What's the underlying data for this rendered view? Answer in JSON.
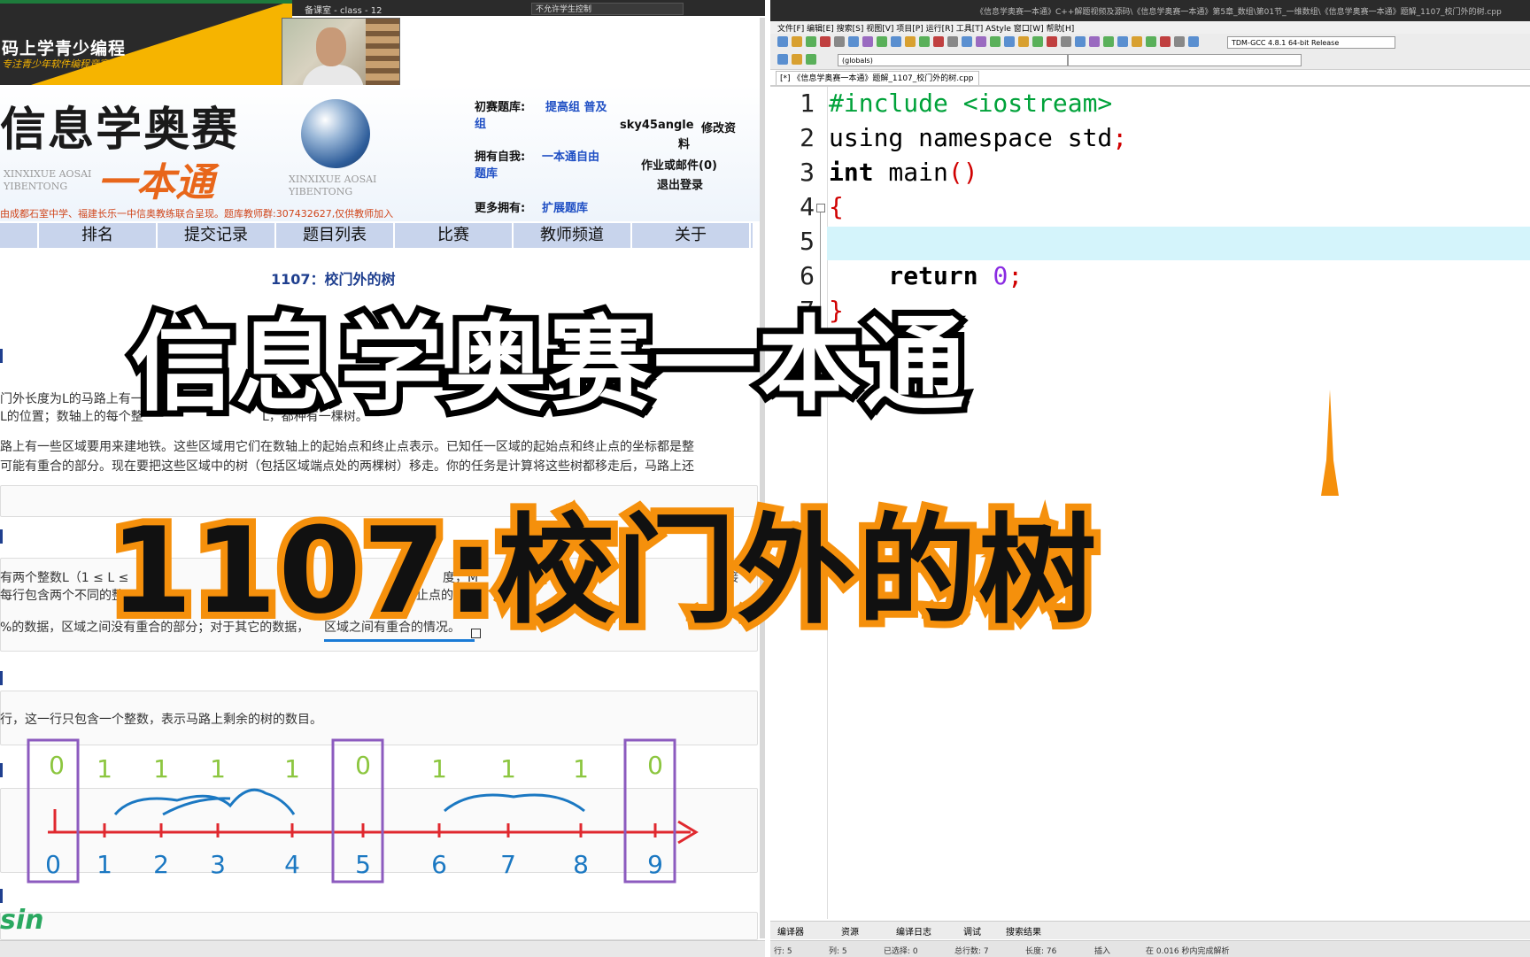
{
  "left_page": {
    "class_title": "备课室 - class - 12",
    "logo_text": "码上学青少编程",
    "logo_sub": "专注青少年软件编程竞赛",
    "brand_big": "信息学奥赛",
    "brand_pinyin": "XINXIXUE AOSAI YIBENTONG",
    "brand_yibentong": "一本通",
    "brand_pinyin2": "XINXIXUE AOSAI YIBENTONG",
    "brand_credit": "由成都石室中学、福建长乐一中信奥教练联合呈现。题库教师群:307432627,仅供教师加入",
    "info": {
      "prelim_label": "初赛题库:",
      "prelim_link": "提高组 普及组",
      "self_label": "拥有自我:",
      "self_link": "一本通自由题库",
      "more_label": "更多拥有:",
      "more_link": "扩展题库"
    },
    "user": {
      "name": "sky45angle",
      "edit": "修改资",
      "edit2": "料",
      "mail": "作业或邮件(0)",
      "logout": "退出登录"
    },
    "nav": [
      "排名",
      "提交记录",
      "题目列表",
      "比赛",
      "教师频道",
      "关于"
    ],
    "problem_title": "1107：校门外的树",
    "desc_lines": [
      "门外长度为L的马路上有一排树",
      "L的位置；数轴上的每个整",
      "路上有一些区域要用来建地铁。这些区域用它们在数轴上的起始点和终止点表示。已知任一区域的起始点和终止点的坐标都是整",
      "可能有重合的部分。现在要把这些区域中的树（包括区域端点处的两棵树）移走。你的任务是计算将这些树都移走后，马路上还"
    ],
    "desc_tail": "L，都种有一棵树。",
    "input_lines": [
      "有两个整数L（1 ≤ L ≤",
      "每行包含两个不同的整"
    ],
    "input_right": "度，M",
    "input_right2": "数",
    "input_right3": "接",
    "input_right4": "止点的",
    "data_note_a": "%的数据，区域之间没有重合的部分；对于其它的数据，",
    "data_note_b": "区域之间有重合的情况。",
    "output_line": "行，这一行只包含一个整数，表示马路上剩余的树的数目。",
    "sin_logo": "sin"
  },
  "diagram": {
    "top_values": [
      "0",
      "1",
      "1",
      "1",
      "1",
      "0",
      "1",
      "1",
      "1",
      "0"
    ],
    "bottom_labels": [
      "0",
      "1",
      "2",
      "3",
      "4",
      "5",
      "6",
      "7",
      "8",
      "9"
    ],
    "boxed_positions": [
      "0",
      "5",
      "9"
    ],
    "colors": {
      "axis": "#e0282e",
      "top": "#8cc63f",
      "bottom": "#1b78c2",
      "box": "#8c5bbf",
      "brace": "#1b78c2"
    }
  },
  "ide": {
    "path": "《信息学奥赛一本通》C++解题视频及源码\\《信息学奥赛一本通》第5章_数组\\第01节_一维数组\\《信息学奥赛一本通》题解_1107_校门外的树.cpp",
    "menus": "文件[F]  编辑[E]  搜索[S]  视图[V]  项目[P]  运行[R]  工具[T]  AStyle  窗口[W]  帮助[H]",
    "compiler": "TDM-GCC 4.8.1 64-bit Release",
    "globals": "(globals)",
    "tab": "[*] 《信息学奥赛一本通》题解_1107_校门外的树.cpp",
    "line_numbers": [
      "1",
      "2",
      "3",
      "4",
      "5",
      "6",
      "7"
    ],
    "code": {
      "l1_a": "#include ",
      "l1_b": "<iostream>",
      "l2_a": "using namespace std",
      "l2_b": ";",
      "l3_a": "int",
      "l3_b": " main",
      "l3_c": "()",
      "l4": "{",
      "l6_a": "    return ",
      "l6_b": "0",
      "l6_c": ";",
      "l7": "}"
    },
    "bottom_tabs": [
      "编译器",
      "资源",
      "编译日志",
      "调试",
      "搜索结果"
    ],
    "status": {
      "row": "行:  5",
      "col": "列:  5",
      "sel": "已选择:  0",
      "total": "总行数:  7",
      "len": "长度:  76",
      "mode": "插入",
      "parse": "在 0.016 秒内完成解析"
    },
    "top_control": "不允许学生控制"
  },
  "overlay": {
    "title1": "信息学奥赛一本通",
    "title2": "1107:校门外的树",
    "stroke_white_title": "#000000",
    "stroke_orange_title": "#f5900c"
  }
}
